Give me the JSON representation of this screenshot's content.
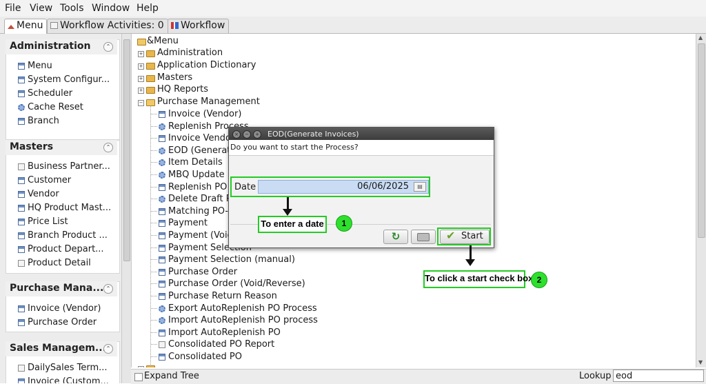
{
  "menubar": {
    "items": [
      "File",
      "View",
      "Tools",
      "Window",
      "Help"
    ]
  },
  "tabs": [
    {
      "label": "Menu",
      "icon": "home-icon"
    },
    {
      "label": "Workflow Activities: 0",
      "icon": "doc-icon"
    },
    {
      "label": "Workflow",
      "icon": "workflow-icon"
    }
  ],
  "sidebar": {
    "sections": [
      {
        "title": "Administration",
        "items": [
          {
            "label": "Menu",
            "icon": "window-icon"
          },
          {
            "label": "System Configur...",
            "icon": "window-icon"
          },
          {
            "label": "Scheduler",
            "icon": "window-icon"
          },
          {
            "label": "Cache Reset",
            "icon": "gear-icon"
          },
          {
            "label": "Branch",
            "icon": "window-icon"
          }
        ]
      },
      {
        "title": "Masters",
        "items": [
          {
            "label": "Business Partner...",
            "icon": "doc-icon"
          },
          {
            "label": "Customer",
            "icon": "window-icon"
          },
          {
            "label": "Vendor",
            "icon": "window-icon"
          },
          {
            "label": "HQ Product Mast...",
            "icon": "window-icon"
          },
          {
            "label": "Price List",
            "icon": "window-icon"
          },
          {
            "label": "Branch Product ...",
            "icon": "window-icon"
          },
          {
            "label": "Product Depart...",
            "icon": "window-icon"
          },
          {
            "label": "Product Detail",
            "icon": "doc-icon"
          }
        ]
      },
      {
        "title": "Purchase Mana...",
        "items": [
          {
            "label": "Invoice (Vendor)",
            "icon": "window-icon"
          },
          {
            "label": "Purchase Order",
            "icon": "window-icon"
          }
        ]
      },
      {
        "title": "Sales Managem...",
        "items": [
          {
            "label": "DailySales Term...",
            "icon": "doc-icon"
          },
          {
            "label": "Invoice (Custom...",
            "icon": "window-icon"
          }
        ]
      }
    ]
  },
  "tree": {
    "root": "&Menu",
    "folders": [
      "Administration",
      "Application Dictionary",
      "Masters",
      "HQ Reports"
    ],
    "open_folder": "Purchase Management",
    "children": [
      {
        "label": "Invoice (Vendor)",
        "icon": "window-icon"
      },
      {
        "label": "Replenish Process",
        "icon": "gear-icon"
      },
      {
        "label": "Invoice Vendor",
        "icon": "window-icon"
      },
      {
        "label": "EOD (Generate",
        "icon": "gear-icon"
      },
      {
        "label": "Item Details",
        "icon": "gear-icon"
      },
      {
        "label": "MBQ Update F",
        "icon": "gear-icon"
      },
      {
        "label": "Replenish PO",
        "icon": "window-icon"
      },
      {
        "label": "Delete Draft P",
        "icon": "gear-icon"
      },
      {
        "label": "Matching PO-I",
        "icon": "window-icon"
      },
      {
        "label": "Payment",
        "icon": "window-icon"
      },
      {
        "label": "Payment (Void",
        "icon": "window-icon"
      },
      {
        "label": "Payment Selection",
        "icon": "window-icon"
      },
      {
        "label": "Payment Selection (manual)",
        "icon": "window-icon"
      },
      {
        "label": "Purchase Order",
        "icon": "window-icon"
      },
      {
        "label": "Purchase Order (Void/Reverse)",
        "icon": "window-icon"
      },
      {
        "label": "Purchase Return Reason",
        "icon": "window-icon"
      },
      {
        "label": "Export AutoReplenish PO Process",
        "icon": "gear-icon"
      },
      {
        "label": "Import AutoReplenish PO process",
        "icon": "gear-icon"
      },
      {
        "label": "Import AutoReplenish PO",
        "icon": "window-icon"
      },
      {
        "label": "Consolidated PO Report",
        "icon": "doc-icon"
      },
      {
        "label": "Consolidated PO",
        "icon": "window-icon"
      }
    ]
  },
  "bottom": {
    "expand_tree": "Expand Tree",
    "lookup_label": "Lookup",
    "lookup_value": "eod"
  },
  "dialog": {
    "title": "EOD(Generate Invoices)",
    "question": "Do you want to start the Process?",
    "date_label": "Date",
    "date_value": "06/06/2025",
    "start_label": "Start"
  },
  "annotations": {
    "note1": "To enter a date",
    "badge1": "1",
    "note2": "To click a start check box",
    "badge2": "2",
    "highlight_color": "#22cc22"
  }
}
